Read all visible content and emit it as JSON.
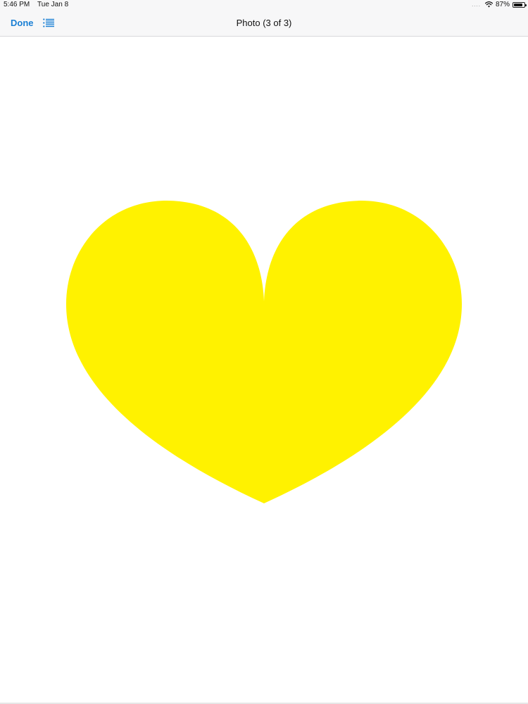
{
  "status_bar": {
    "time": "5:46 PM",
    "date": "Tue Jan 8",
    "signal_dots": "....",
    "battery_percent_label": "87%",
    "battery_level": 0.87,
    "wifi_icon": "wifi-icon",
    "battery_icon": "battery-icon"
  },
  "nav_bar": {
    "done_label": "Done",
    "list_icon": "list-icon",
    "title": "Photo (3 of 3)"
  },
  "photo": {
    "subject": "heart",
    "heart_color": "#FFF200",
    "background_color": "#FFFFFF"
  },
  "colors": {
    "accent": "#1A7FD4",
    "bar_background": "#F7F7F8"
  }
}
